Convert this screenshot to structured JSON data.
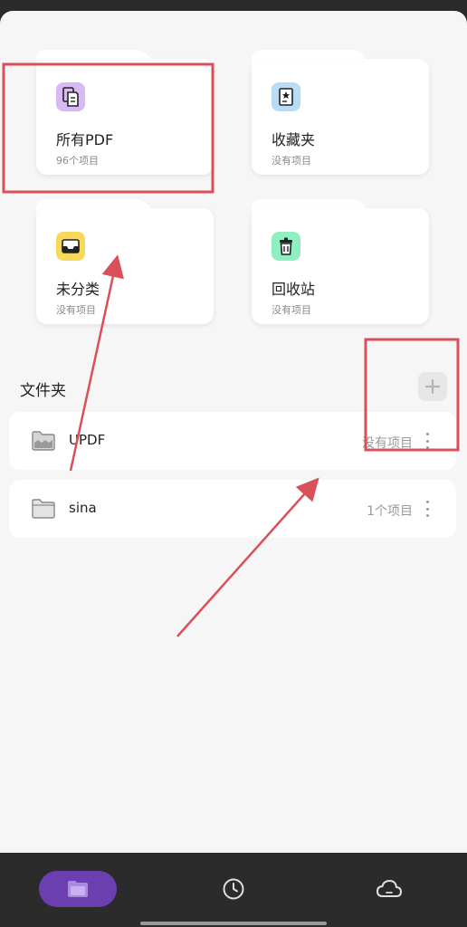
{
  "cards": [
    {
      "title": "所有PDF",
      "sub": "96个项目",
      "icon": "pdf-stack-icon",
      "icon_bg": "#d8b8f5"
    },
    {
      "title": "收藏夹",
      "sub": "没有项目",
      "icon": "favorite-doc-icon",
      "icon_bg": "#b8dcf5"
    },
    {
      "title": "未分类",
      "sub": "没有项目",
      "icon": "inbox-tray-icon",
      "icon_bg": "#f7d95a"
    },
    {
      "title": "回收站",
      "sub": "没有项目",
      "icon": "trash-icon",
      "icon_bg": "#8ef0c0"
    }
  ],
  "folders_section": {
    "title": "文件夹",
    "add_icon": "plus-icon"
  },
  "folders": [
    {
      "name": "UPDF",
      "count": "没有项目"
    },
    {
      "name": "sina",
      "count": "1个项目"
    }
  ],
  "bottom_nav": [
    {
      "icon": "folder-icon",
      "active": true
    },
    {
      "icon": "clock-icon",
      "active": false
    },
    {
      "icon": "cloud-icon",
      "active": false
    }
  ],
  "colors": {
    "accent": "#6b3fb0",
    "annotation": "#d9505a"
  }
}
